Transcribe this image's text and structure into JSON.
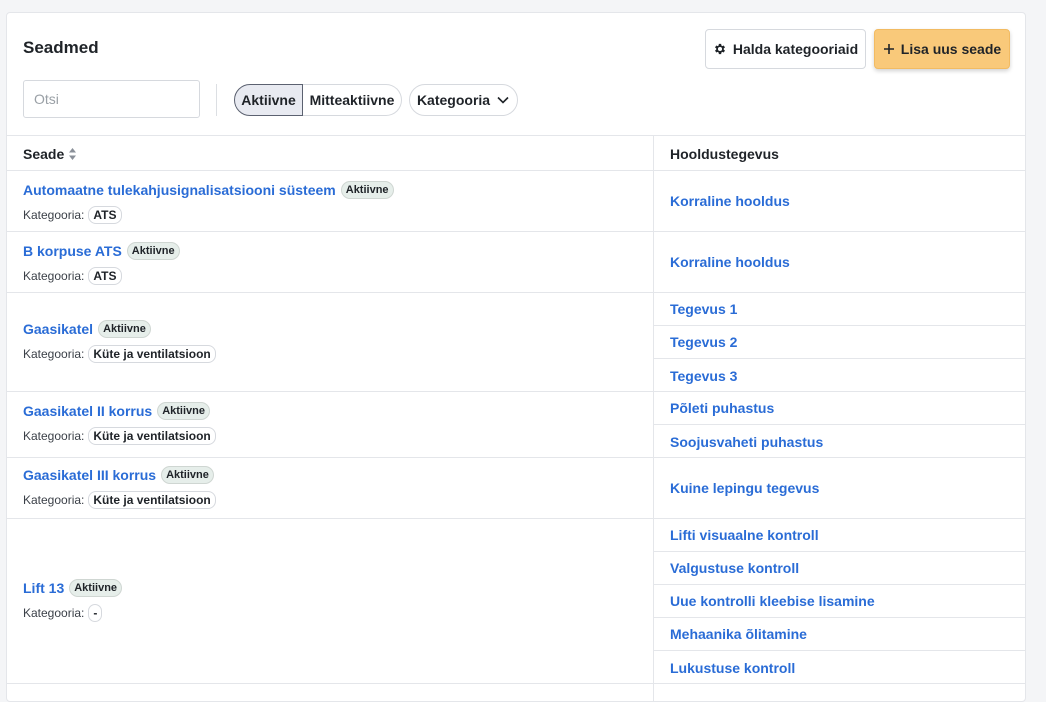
{
  "header": {
    "title": "Seadmed",
    "manage_label": "Halda kategooriaid",
    "add_label": "Lisa uus seade"
  },
  "filters": {
    "search_placeholder": "Otsi",
    "active_label": "Aktiivne",
    "inactive_label": "Mitteaktiivne",
    "category_label": "Kategooria"
  },
  "table": {
    "col_device": "Seade",
    "col_actions": "Hooldustegevus",
    "category_prefix": "Kategooria:",
    "rows": [
      {
        "name": "Automaatne tulekahjusignalisatsiooni süsteem",
        "status": "Aktiivne",
        "category": "ATS",
        "actions": [
          "Korraline hooldus"
        ]
      },
      {
        "name": "B korpuse ATS",
        "status": "Aktiivne",
        "category": "ATS",
        "actions": [
          "Korraline hooldus"
        ]
      },
      {
        "name": "Gaasikatel",
        "status": "Aktiivne",
        "category": "Küte ja ventilatsioon",
        "actions": [
          "Tegevus 1",
          "Tegevus 2",
          "Tegevus 3"
        ]
      },
      {
        "name": "Gaasikatel II korrus",
        "status": "Aktiivne",
        "category": "Küte ja ventilatsioon",
        "actions": [
          "Põleti puhastus",
          "Soojusvaheti puhastus"
        ]
      },
      {
        "name": "Gaasikatel III korrus",
        "status": "Aktiivne",
        "category": "Küte ja ventilatsioon",
        "actions": [
          "Kuine lepingu tegevus"
        ]
      },
      {
        "name": "Lift 13",
        "status": "Aktiivne",
        "category": "-",
        "actions": [
          "Lifti visuaalne kontroll",
          "Valgustuse kontroll",
          "Uue kontrolli kleebise lisamine",
          "Mehaanika õlitamine",
          "Lukustuse kontroll"
        ]
      }
    ]
  },
  "colors": {
    "link": "#2a6cd6",
    "accent": "#f9c97a",
    "badge_bg": "#e6eeea"
  }
}
